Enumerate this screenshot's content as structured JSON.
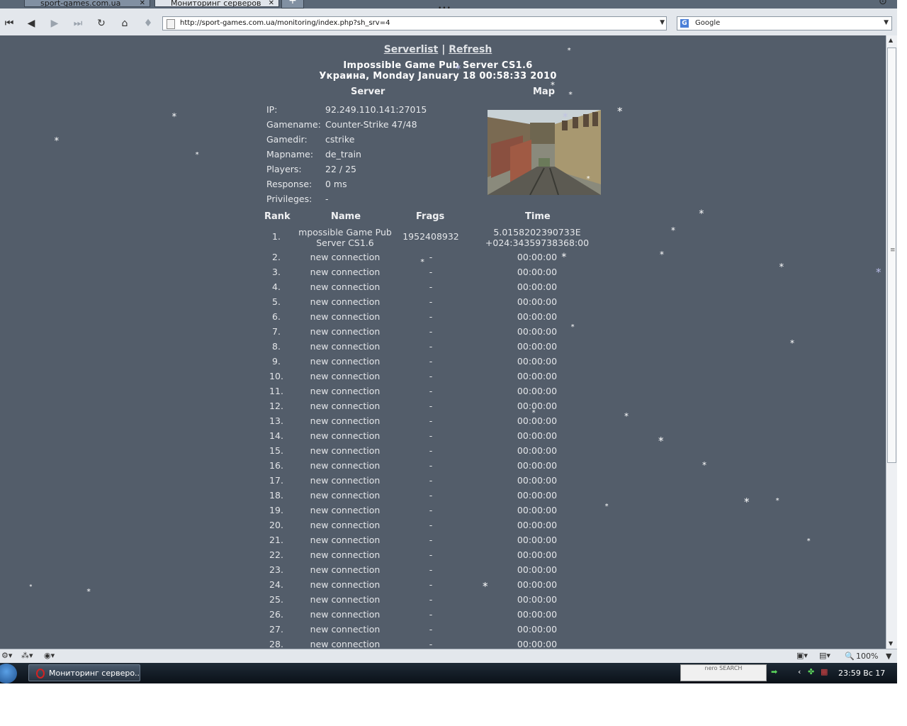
{
  "browser": {
    "tabs": [
      {
        "label": "sport-games.com.ua",
        "active": false
      },
      {
        "label": "Мониторинг серверов",
        "active": true
      }
    ],
    "grip": "•••",
    "url": "http://sport-games.com.ua/monitoring/index.php?sh_srv=4",
    "search_engine": "Google",
    "zoom": "100%"
  },
  "page": {
    "links": {
      "serverlist": "Serverlist",
      "separator": "|",
      "refresh": "Refresh"
    },
    "server_name": "Impossible Game Pub Server CS1.6",
    "datetime": "Украина, Monday January 18 00:58:33 2010",
    "server_heading": "Server",
    "map_heading": "Map",
    "info": [
      {
        "label": "IP:",
        "value": "92.249.110.141:27015"
      },
      {
        "label": "Gamename:",
        "value": "Counter-Strike 47/48"
      },
      {
        "label": "Gamedir:",
        "value": "cstrike"
      },
      {
        "label": "Mapname:",
        "value": "de_train"
      },
      {
        "label": "Players:",
        "value": "22 / 25"
      },
      {
        "label": "Response:",
        "value": "0 ms"
      },
      {
        "label": "Privileges:",
        "value": "-"
      }
    ],
    "table_headers": {
      "rank": "Rank",
      "name": "Name",
      "frags": "Frags",
      "time": "Time"
    },
    "first_player": {
      "rank": "1.",
      "name_line1": "mpossible Game Pub",
      "name_line2": "Server CS1.6",
      "frags": "1952408932",
      "time_line1": "5.0158202390733E",
      "time_line2": "+024:34359738368:00"
    },
    "players": [
      {
        "rank": "2.",
        "name": "new connection",
        "frags": "-",
        "time": "00:00:00"
      },
      {
        "rank": "3.",
        "name": "new connection",
        "frags": "-",
        "time": "00:00:00"
      },
      {
        "rank": "4.",
        "name": "new connection",
        "frags": "-",
        "time": "00:00:00"
      },
      {
        "rank": "5.",
        "name": "new connection",
        "frags": "-",
        "time": "00:00:00"
      },
      {
        "rank": "6.",
        "name": "new connection",
        "frags": "-",
        "time": "00:00:00"
      },
      {
        "rank": "7.",
        "name": "new connection",
        "frags": "-",
        "time": "00:00:00"
      },
      {
        "rank": "8.",
        "name": "new connection",
        "frags": "-",
        "time": "00:00:00"
      },
      {
        "rank": "9.",
        "name": "new connection",
        "frags": "-",
        "time": "00:00:00"
      },
      {
        "rank": "10.",
        "name": "new connection",
        "frags": "-",
        "time": "00:00:00"
      },
      {
        "rank": "11.",
        "name": "new connection",
        "frags": "-",
        "time": "00:00:00"
      },
      {
        "rank": "12.",
        "name": "new connection",
        "frags": "-",
        "time": "00:00:00"
      },
      {
        "rank": "13.",
        "name": "new connection",
        "frags": "-",
        "time": "00:00:00"
      },
      {
        "rank": "14.",
        "name": "new connection",
        "frags": "-",
        "time": "00:00:00"
      },
      {
        "rank": "15.",
        "name": "new connection",
        "frags": "-",
        "time": "00:00:00"
      },
      {
        "rank": "16.",
        "name": "new connection",
        "frags": "-",
        "time": "00:00:00"
      },
      {
        "rank": "17.",
        "name": "new connection",
        "frags": "-",
        "time": "00:00:00"
      },
      {
        "rank": "18.",
        "name": "new connection",
        "frags": "-",
        "time": "00:00:00"
      },
      {
        "rank": "19.",
        "name": "new connection",
        "frags": "-",
        "time": "00:00:00"
      },
      {
        "rank": "20.",
        "name": "new connection",
        "frags": "-",
        "time": "00:00:00"
      },
      {
        "rank": "21.",
        "name": "new connection",
        "frags": "-",
        "time": "00:00:00"
      },
      {
        "rank": "22.",
        "name": "new connection",
        "frags": "-",
        "time": "00:00:00"
      },
      {
        "rank": "23.",
        "name": "new connection",
        "frags": "-",
        "time": "00:00:00"
      },
      {
        "rank": "24.",
        "name": "new connection",
        "frags": "-",
        "time": "00:00:00"
      },
      {
        "rank": "25.",
        "name": "new connection",
        "frags": "-",
        "time": "00:00:00"
      },
      {
        "rank": "26.",
        "name": "new connection",
        "frags": "-",
        "time": "00:00:00"
      },
      {
        "rank": "27.",
        "name": "new connection",
        "frags": "-",
        "time": "00:00:00"
      },
      {
        "rank": "28.",
        "name": "new connection",
        "frags": "-",
        "time": "00:00:00"
      }
    ],
    "snow_glyph": "*"
  },
  "taskbar": {
    "window_label": "Мониторинг серверо...",
    "nero_label": "nero SEARCH",
    "clock": "23:59 Вс 17"
  },
  "colors": {
    "page_bg": "#535d6a",
    "text": "#e4e6e9"
  }
}
